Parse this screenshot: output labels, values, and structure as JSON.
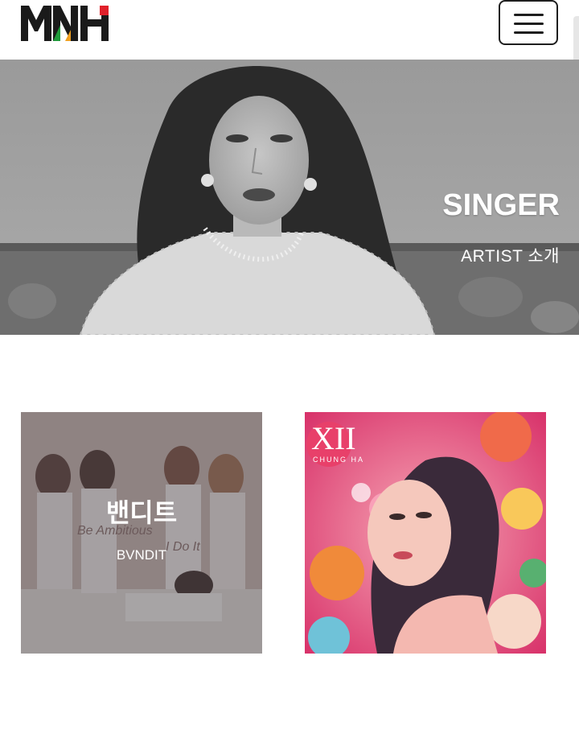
{
  "header": {
    "logo_text": "MNH",
    "menu_icon": "hamburger-menu-icon"
  },
  "hero": {
    "title": "SINGER",
    "subtitle": "ARTIST  소개"
  },
  "artists": [
    {
      "name": "밴디트",
      "sub": "BVNDIT",
      "cover_text": [
        "Be Ambitious",
        "I Do It"
      ]
    },
    {
      "name": "",
      "sub": "",
      "cover_text": [
        "XII",
        "CHUNG HA"
      ]
    }
  ],
  "colors": {
    "logo_black": "#1a1a1a",
    "logo_red": "#e0202a",
    "logo_green": "#1f9a3a",
    "logo_orange": "#f0a020"
  }
}
